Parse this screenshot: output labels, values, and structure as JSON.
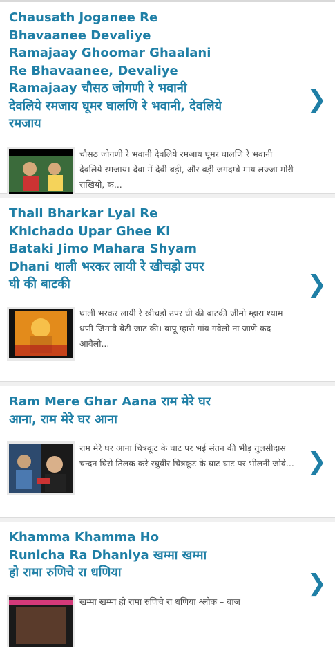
{
  "items": [
    {
      "title": "Chausath Joganee Re Bhavaanee Devaliye Ramajaay Ghoomar Ghaalani Re Bhavaanee, Devaliye Ramajaay चौसठ जोगणी रे भवानी देवलिये रमजाय घूमर घालणि रे भवानी, देवलिये रमजाय",
      "snippet": "चौसठ जोगणी रे भवानी देवलिये रमजाय घूमर घालणि रे भवानी देवलिये रमजाय। देवा में देवी बड़ी, और बड़ी जगदम्बे माय लज्जा मोरी राखियो, क...",
      "thumb_icon": "devotional-video-thumbnail-icon"
    },
    {
      "title": "Thali Bharkar Lyai Re Khichado Upar Ghee Ki Bataki Jimo Mahara Shyam Dhani थाली भरकर लायी रे खीचड़ो उपर घी की बाटकी",
      "snippet": "थाली भरकर लायी रे खीचड़ो उपर घी की बाटकी जीमो म्हारा श्याम धणी जिमावै बेटी जाट की। बापू म्हारो गांव गवेलो ना जाणे कद आवैलो...",
      "thumb_icon": "deity-image-thumbnail-icon"
    },
    {
      "title": "Ram Mere Ghar Aana राम मेरे घर आना, राम मेरे घर आना",
      "snippet": "राम मेरे घर आना चित्रकूट के घाट पर भई संतन की भीड़ तुलसीदास चन्दन घिसे तिलक करे रघुवीर चित्रकूट के घाट घाट पर भीलनी जोवे...",
      "thumb_icon": "ram-bhajan-thumbnail-icon"
    },
    {
      "title": "Khamma Khamma Ho Runicha Ra Dhaniya खम्मा खम्मा हो रामा रुणिचे रा धणिया",
      "snippet": "खम्मा खम्मा हो रामा रुणिचे रा धणिया श्लोक – बाज",
      "thumb_icon": "khamma-bhajan-thumbnail-icon"
    }
  ],
  "chevron_glyph": "❯",
  "colors": {
    "accent": "#1f7fa6",
    "text": "#4a4a4a",
    "divider": "#dcdcdc"
  }
}
